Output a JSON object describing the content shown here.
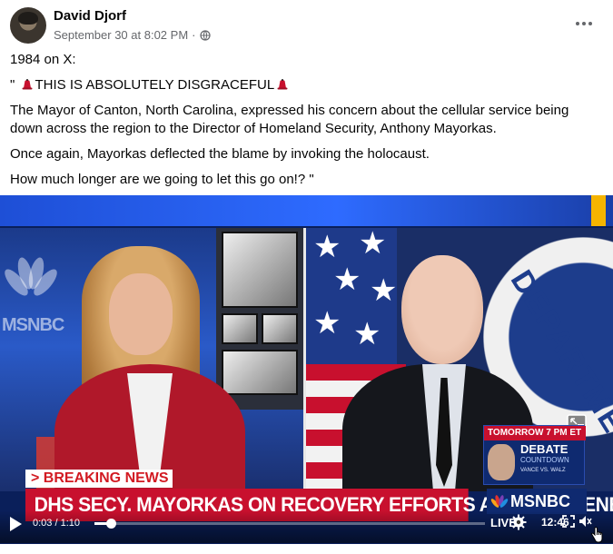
{
  "post": {
    "author": "David Djorf",
    "timestamp": "September 30 at 8:02 PM",
    "separator": "·",
    "privacy_icon": "globe-icon",
    "more_icon": "more-options-icon"
  },
  "content": {
    "line1": "1984 on X:",
    "line2_prefix": "\"",
    "line2_text": "THIS IS ABSOLUTELY DISGRACEFUL",
    "line2_emoji": "red-hat-emoji",
    "paragraph1": "The Mayor of Canton, North Carolina, expressed his concern about the cellular service being down across the region to the Director of Homeland Security, Anthony Mayorkas.",
    "paragraph2": "Once again, Mayorkas deflected the blame by invoking the holocaust.",
    "paragraph3": "How much longer are we going to let this go on!? \""
  },
  "video": {
    "left_logo": "MSNBC",
    "seal_text": "DEPARTME",
    "breaking_label": "> BREAKING NEWS",
    "chyron": "DHS SECY. MAYORKAS ON RECOVERY EFFORTS AFTER HELENE",
    "network": "MSNBC",
    "countdown": {
      "header": "TOMORROW 7 PM ET",
      "title": "DEBATE",
      "subtitle": "COUNTDOWN",
      "names": "VANCE VS. WALZ"
    },
    "controls": {
      "current_time": "0:03",
      "duration": "1:10",
      "progress": 0.043,
      "live_label": "LIVE",
      "clock": "12:46",
      "time_separator": " / "
    }
  },
  "colors": {
    "accent_blue": "#1e4fd6",
    "chyron_red": "#c8102e",
    "text_secondary": "#65676b"
  }
}
